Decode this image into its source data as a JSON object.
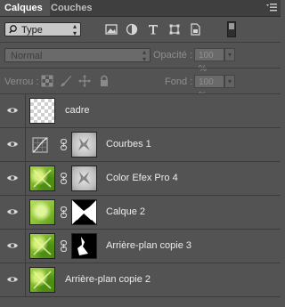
{
  "tabs": [
    {
      "label": "Calques",
      "active": true
    },
    {
      "label": "Couches",
      "active": false
    }
  ],
  "panel_menu_icon": "panel-menu-icon",
  "filter": {
    "selected": "Type",
    "icons": [
      "image-filter-icon",
      "adjustment-filter-icon",
      "type-filter-icon",
      "shape-filter-icon",
      "smart-object-filter-icon"
    ]
  },
  "blend": {
    "mode": "Normal",
    "opacity_label": "Opacité :",
    "opacity_value": "100 %",
    "fill_label": "Fond :",
    "fill_value": "100 %"
  },
  "lock": {
    "label": "Verrou :",
    "icons": [
      "lock-transparent-pixels-icon",
      "lock-image-pixels-icon",
      "lock-position-icon",
      "lock-all-icon"
    ]
  },
  "layers": [
    {
      "name": "cadre",
      "visible": true,
      "thumb": "transparent",
      "mask": null,
      "adjustment": false
    },
    {
      "name": "Courbes 1",
      "visible": true,
      "thumb": null,
      "mask": "gray",
      "adjustment": true
    },
    {
      "name": "Color Efex Pro 4",
      "visible": true,
      "thumb": "green",
      "mask": "gray",
      "adjustment": false
    },
    {
      "name": "Calque 2",
      "visible": true,
      "thumb": "green-light",
      "mask": "black-white",
      "adjustment": false
    },
    {
      "name": "Arrière-plan copie 3",
      "visible": true,
      "thumb": "green",
      "mask": "black",
      "adjustment": false
    },
    {
      "name": "Arrière-plan copie 2",
      "visible": true,
      "thumb": "green",
      "mask": null,
      "adjustment": false
    }
  ],
  "colors": {
    "panel_bg": "#535353",
    "tab_bar_bg": "#3f3f3f",
    "text": "#e6e6e6"
  }
}
